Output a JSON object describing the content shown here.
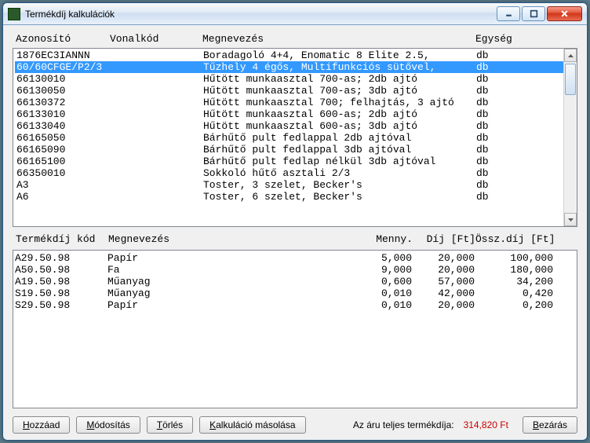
{
  "window": {
    "title": "Termékdíj kalkulációk"
  },
  "headers1": {
    "azonosito": "Azonosító",
    "vonalkod": "Vonalkód",
    "megnevezes": "Megnevezés",
    "egyseg": "Egység"
  },
  "products": [
    {
      "az": "1876EC3IANNN",
      "vk": "",
      "meg": "Boradagoló 4+4, Enomatic 8 Elite 2.5,",
      "egy": "db",
      "sel": false
    },
    {
      "az": "60/60CFGE/P2/3",
      "vk": "",
      "meg": "Tűzhely 4 égős, Multifunkciós sütővel,",
      "egy": "db",
      "sel": true
    },
    {
      "az": "66130010",
      "vk": "",
      "meg": "Hűtött munkaasztal 700-as; 2db ajtó",
      "egy": "db",
      "sel": false
    },
    {
      "az": "66130050",
      "vk": "",
      "meg": "Hűtött munkaasztal 700-as; 3db ajtó",
      "egy": "db",
      "sel": false
    },
    {
      "az": "66130372",
      "vk": "",
      "meg": "Hűtött munkaasztal 700; felhajtás, 3 ajtó",
      "egy": "db",
      "sel": false
    },
    {
      "az": "66133010",
      "vk": "",
      "meg": "Hűtött munkaasztal 600-as; 2db ajtó",
      "egy": "db",
      "sel": false
    },
    {
      "az": "66133040",
      "vk": "",
      "meg": "Hűtött munkaasztal 600-as; 3db ajtó",
      "egy": "db",
      "sel": false
    },
    {
      "az": "66165050",
      "vk": "",
      "meg": "Bárhűtő pult fedlappal 2db ajtóval",
      "egy": "db",
      "sel": false
    },
    {
      "az": "66165090",
      "vk": "",
      "meg": "Bárhűtő pult fedlappal 3db ajtóval",
      "egy": "db",
      "sel": false
    },
    {
      "az": "66165100",
      "vk": "",
      "meg": "Bárhűtő pult fedlap nélkül 3db ajtóval",
      "egy": "db",
      "sel": false
    },
    {
      "az": "66350010",
      "vk": "",
      "meg": "Sokkoló hűtő asztali 2/3",
      "egy": "db",
      "sel": false
    },
    {
      "az": "A3",
      "vk": "",
      "meg": "Toster, 3 szelet, Becker's",
      "egy": "db",
      "sel": false
    },
    {
      "az": "A6",
      "vk": "",
      "meg": "Toster, 6 szelet, Becker's",
      "egy": "db",
      "sel": false
    }
  ],
  "headers2": {
    "kod": "Termékdíj kód",
    "megnevezes": "Megnevezés",
    "menny": "Menny.",
    "dij": "Díj [Ft]",
    "ossz": "Össz.díj [Ft]"
  },
  "materials": [
    {
      "kod": "A29.50.98",
      "meg": "Papír",
      "menny": "5,000",
      "dij": "20,000",
      "ossz": "100,000"
    },
    {
      "kod": "A50.50.98",
      "meg": "Fa",
      "menny": "9,000",
      "dij": "20,000",
      "ossz": "180,000"
    },
    {
      "kod": "A19.50.98",
      "meg": "Műanyag",
      "menny": "0,600",
      "dij": "57,000",
      "ossz": "34,200"
    },
    {
      "kod": "S19.50.98",
      "meg": "Műanyag",
      "menny": "0,010",
      "dij": "42,000",
      "ossz": "0,420"
    },
    {
      "kod": "S29.50.98",
      "meg": "Papír",
      "menny": "0,010",
      "dij": "20,000",
      "ossz": "0,200"
    }
  ],
  "footer": {
    "hozzaad": "Hozzáad",
    "modositas": "Módosítás",
    "torles": "Törlés",
    "masolas": "Kalkuláció másolása",
    "totalLabel": "Az áru teljes termékdíja:",
    "totalValue": "314,820 Ft",
    "bezaras": "Bezárás"
  }
}
